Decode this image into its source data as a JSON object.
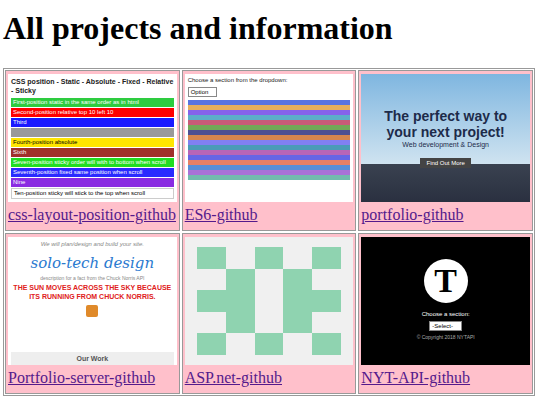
{
  "page": {
    "title": "All projects and information"
  },
  "projects": [
    {
      "link": "css-layout-position-github",
      "preview": {
        "kind": "css-position",
        "title": "CSS position - Static - Absolute - Fixed - Relative - Sticky",
        "bars": [
          {
            "text": "First-position static in the same order as in html",
            "color": "#2ecc40"
          },
          {
            "text": "Second-position relative top 10 left 10",
            "color": "#ff0000"
          },
          {
            "text": "Third",
            "color": "#1a1aff"
          },
          {
            "text": "",
            "color": "#9a9a9a"
          },
          {
            "text": "Fourth-position absolute",
            "color": "#ffe600"
          },
          {
            "text": "Sixth",
            "color": "#a0302a"
          },
          {
            "text": "Seven-position sticky order will with to bottom when scroll",
            "color": "#22dd22"
          },
          {
            "text": "Seventh-position fixed same position when scroll",
            "color": "#2a2aff"
          },
          {
            "text": "Nine",
            "color": "#8a2be2"
          },
          {
            "text": "Ten-position sticky will stick to the top when scroll",
            "color": "#ffffff"
          }
        ]
      }
    },
    {
      "link": "ES6-github",
      "preview": {
        "kind": "es6",
        "prompt": "Choose a section from the dropdown:",
        "select": "Option",
        "stripes": [
          "#3b5bdb",
          "#e0a040",
          "#7048e8",
          "#40a0c0",
          "#c04060",
          "#5a9a3a",
          "#303080",
          "#d07030",
          "#6a6aee",
          "#2a8aaa",
          "#aa4aaa",
          "#4a4ae0",
          "#e06a4a",
          "#3a7ad0",
          "#9a5ad0",
          "#5ab0a0"
        ]
      }
    },
    {
      "link": "portfolio-github",
      "preview": {
        "kind": "portfolio",
        "heading": "The perfect way to your next project!",
        "subheading": "Web development & Design",
        "button": "Find Out More"
      }
    },
    {
      "link": "Portfolio-server-github",
      "preview": {
        "kind": "solo",
        "tagline": "We will plan/design and build your site.",
        "brand": "solo-tech design",
        "note": "description for a fact from the Chuck Norris API",
        "fact": "THE SUN MOVES ACROSS THE SKY BECAUSE ITS RUNNING FROM CHUCK NORRIS.",
        "section": "Our Work"
      }
    },
    {
      "link": "ASP.net-github",
      "preview": {
        "kind": "asp",
        "pattern": [
          [
            1,
            0,
            1,
            0,
            1
          ],
          [
            0,
            1,
            0,
            1,
            0
          ],
          [
            1,
            1,
            0,
            1,
            1
          ],
          [
            0,
            1,
            0,
            1,
            0
          ],
          [
            1,
            0,
            1,
            0,
            1
          ]
        ]
      }
    },
    {
      "link": "NYT-API-github",
      "preview": {
        "kind": "nyt",
        "logo": "T",
        "prompt": "Choose a section:",
        "select": "-Select-",
        "footer": "© Copyright 2018 NYTAPI"
      }
    }
  ]
}
